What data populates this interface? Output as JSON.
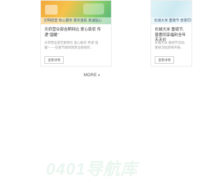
{
  "cards": [
    {
      "title": "天府营业部吉斯特比  爱心助农 传递“温暖”",
      "description": "天府营业部吉斯特比 爱心助农 传递“温暖”——在春节期间我营业部组织...",
      "button": "查看详情",
      "banner": "文明经营  热心服务  惠农富民  真诚贴心"
    },
    {
      "title": "长城大米  重磅节, 普惠同享福利全年  天天价",
      "description": "长城大米 重磅节活动, 重磅活动即将开展...",
      "button": "查看详情",
      "banner": "长城大米  重磅节  普惠同享"
    }
  ],
  "more": {
    "label": "MORE",
    "icon": "chevron-down-icon"
  },
  "watermark": {
    "text": "0401导航库",
    "color": "#eaf6ef"
  }
}
